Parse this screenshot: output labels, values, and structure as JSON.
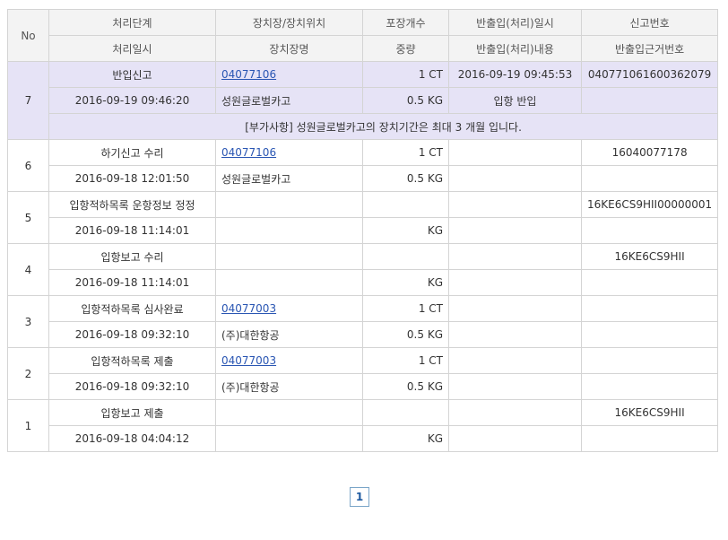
{
  "header": {
    "no": "No",
    "row1": [
      "처리단계",
      "장치장/장치위치",
      "포장개수",
      "반출입(처리)일시",
      "신고번호"
    ],
    "row2": [
      "처리일시",
      "장치장명",
      "중량",
      "반출입(처리)내용",
      "반출입근거번호"
    ]
  },
  "records": [
    {
      "no": "7",
      "step": "반입신고",
      "location": "04077106",
      "packages": "1 CT",
      "io_datetime": "2016-09-19 09:45:53",
      "report_no": "040771061600362079",
      "process_time": "2016-09-19 09:46:20",
      "warehouse": "성원글로벌카고",
      "weight": "0.5 KG",
      "io_content": "입항 반입",
      "basis_no": "",
      "note": "[부가사항] 성원글로벌카고의 장치기간은 최대 3 개월 입니다."
    },
    {
      "no": "6",
      "step": "하기신고 수리",
      "location": "04077106",
      "packages": "1 CT",
      "io_datetime": "",
      "report_no": "16040077178",
      "process_time": "2016-09-18 12:01:50",
      "warehouse": "성원글로벌카고",
      "weight": "0.5 KG",
      "io_content": "",
      "basis_no": ""
    },
    {
      "no": "5",
      "step": "입항적하목록 운항정보 정정",
      "location": "",
      "packages": "",
      "io_datetime": "",
      "report_no": "16KE6CS9HII00000001",
      "process_time": "2016-09-18 11:14:01",
      "warehouse": "",
      "weight": "KG",
      "io_content": "",
      "basis_no": ""
    },
    {
      "no": "4",
      "step": "입항보고 수리",
      "location": "",
      "packages": "",
      "io_datetime": "",
      "report_no": "16KE6CS9HII",
      "process_time": "2016-09-18 11:14:01",
      "warehouse": "",
      "weight": "KG",
      "io_content": "",
      "basis_no": ""
    },
    {
      "no": "3",
      "step": "입항적하목록 심사완료",
      "location": "04077003",
      "packages": "1 CT",
      "io_datetime": "",
      "report_no": "",
      "process_time": "2016-09-18 09:32:10",
      "warehouse": "(주)대한항공",
      "weight": "0.5 KG",
      "io_content": "",
      "basis_no": ""
    },
    {
      "no": "2",
      "step": "입항적하목록 제출",
      "location": "04077003",
      "packages": "1 CT",
      "io_datetime": "",
      "report_no": "",
      "process_time": "2016-09-18 09:32:10",
      "warehouse": "(주)대한항공",
      "weight": "0.5 KG",
      "io_content": "",
      "basis_no": ""
    },
    {
      "no": "1",
      "step": "입항보고 제출",
      "location": "",
      "packages": "",
      "io_datetime": "",
      "report_no": "16KE6CS9HII",
      "process_time": "2016-09-18 04:04:12",
      "warehouse": "",
      "weight": "KG",
      "io_content": "",
      "basis_no": ""
    }
  ],
  "pagination": {
    "current": "1"
  },
  "colors": {
    "highlight_row": "#e6e3f6",
    "header_bg": "#f3f3f3",
    "link": "#2a56b3",
    "border": "#d4d4d4"
  }
}
